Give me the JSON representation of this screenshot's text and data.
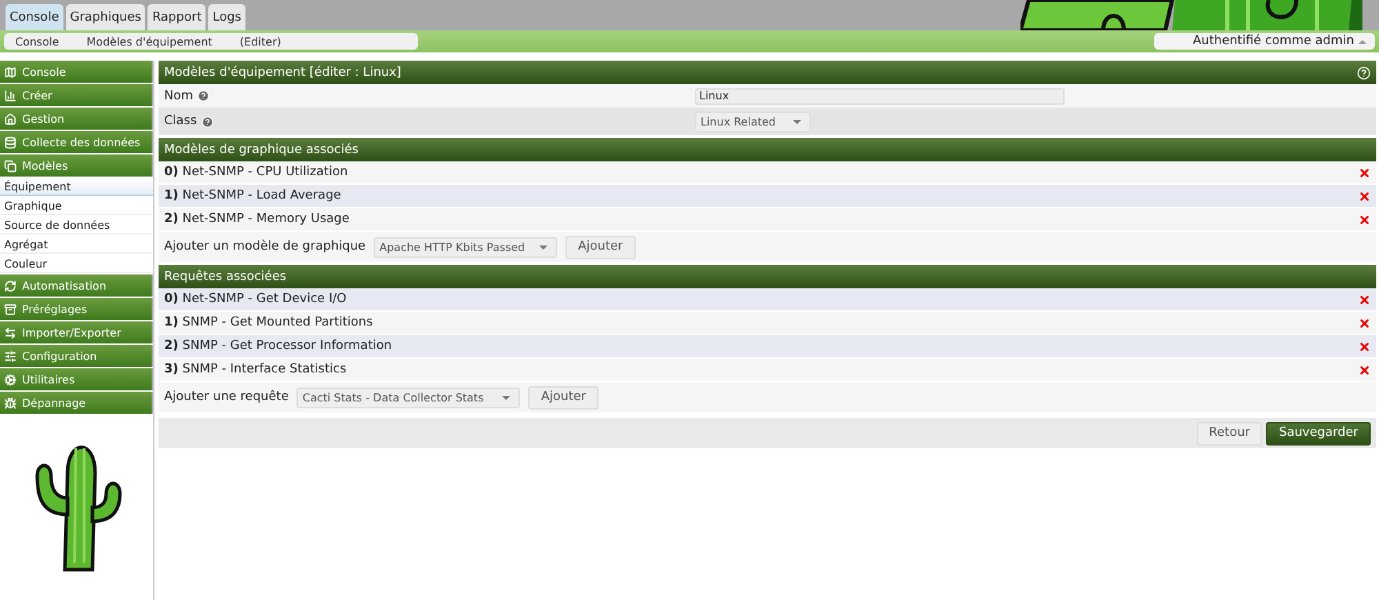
{
  "top_tabs": [
    {
      "label": "Console",
      "selected": true
    },
    {
      "label": "Graphiques",
      "selected": false
    },
    {
      "label": "Rapport",
      "selected": false
    },
    {
      "label": "Logs",
      "selected": false
    }
  ],
  "breadcrumb": [
    "Console",
    "Modèles d'équipement",
    "(Editer)"
  ],
  "user_menu": {
    "label": "Authentifié comme admin"
  },
  "sidebar": {
    "items": [
      {
        "label": "Console"
      },
      {
        "label": "Créer"
      },
      {
        "label": "Gestion"
      },
      {
        "label": "Collecte des données"
      },
      {
        "label": "Modèles",
        "children": [
          {
            "label": "Équipement",
            "selected": true
          },
          {
            "label": "Graphique",
            "selected": false
          },
          {
            "label": "Source de données",
            "selected": false
          },
          {
            "label": "Agrégat",
            "selected": false
          },
          {
            "label": "Couleur",
            "selected": false
          }
        ]
      },
      {
        "label": "Automatisation"
      },
      {
        "label": "Préréglages"
      },
      {
        "label": "Importer/Exporter"
      },
      {
        "label": "Configuration"
      },
      {
        "label": "Utilitaires"
      },
      {
        "label": "Dépannage"
      }
    ]
  },
  "form": {
    "title": "Modèles d'équipement [éditer : Linux]",
    "fields": [
      {
        "label": "Nom",
        "kind": "text",
        "value": "Linux"
      },
      {
        "label": "Class",
        "kind": "select",
        "value": "Linux Related"
      }
    ]
  },
  "graph_templates": {
    "title": "Modèles de graphique associés",
    "rows": [
      "**0)** Net-SNMP - CPU Utilization",
      "**1)** Net-SNMP - Load Average",
      "**2)** Net-SNMP - Memory Usage"
    ],
    "add_label": "Ajouter un modèle de graphique",
    "add_select": "Apache HTTP Kbits Passed",
    "add_button": "Ajouter"
  },
  "queries": {
    "title": "Requêtes associées",
    "rows": [
      "**0)** Net-SNMP - Get Device I/O",
      "**1)** SNMP - Get Mounted Partitions",
      "**2)** SNMP - Get Processor Information",
      "**3)** SNMP - Interface Statistics"
    ],
    "add_label": "Ajouter une requête",
    "add_select": "Cacti Stats - Data Collector Stats",
    "add_button": "Ajouter"
  },
  "buttons": [
    {
      "label": "Retour",
      "kind": "secondary"
    },
    {
      "label": "Sauvegarder",
      "kind": "primary"
    }
  ]
}
